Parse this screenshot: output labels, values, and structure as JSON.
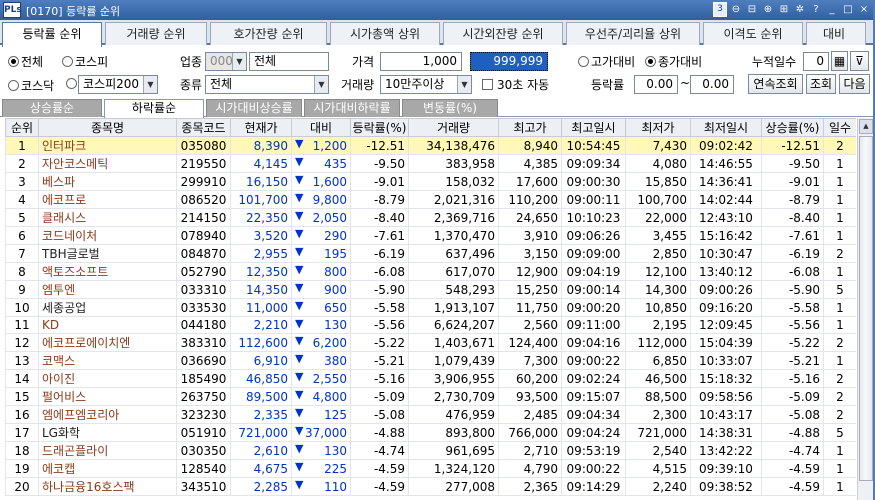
{
  "window": {
    "logo": "PLs",
    "title": "[0170] 등락률 순위",
    "icons": [
      "3",
      "magnify",
      "window",
      "zoom-in",
      "lock",
      "asterisk",
      "help",
      "minimize",
      "maximize",
      "close"
    ],
    "icon_glyphs": [
      "3",
      "⊖",
      "⊟",
      "⊕",
      "⊞",
      "✲",
      "?",
      "_",
      "□",
      "×"
    ]
  },
  "main_tabs": [
    "등락률 순위",
    "거래량 순위",
    "호가잔량 순위",
    "시가총액 상위",
    "시간외잔량 순위",
    "우선주/괴리율 상위",
    "이격도 순위",
    "대비"
  ],
  "filters": {
    "market_radios": [
      {
        "label": "전체",
        "checked": true
      },
      {
        "label": "코스피",
        "checked": false
      },
      {
        "label": "코스닥",
        "checked": false
      }
    ],
    "index_select": "코스피200",
    "sector_label": "업종",
    "sector_code": "0000",
    "sector_name": "전체",
    "type_label": "종류",
    "type_value": "전체",
    "price_label": "가격",
    "price_from": "1,000",
    "price_to": "999,999",
    "volume_label": "거래량",
    "volume_value": "10만주이상",
    "auto_label": "30초 자동",
    "compare_radios": [
      {
        "label": "고가대비",
        "checked": false
      },
      {
        "label": "종가대비",
        "checked": true
      }
    ],
    "rate_label": "등락률",
    "rate_from": "0.00",
    "rate_tilde": "~",
    "rate_to": "0.00",
    "days_label": "누적일수",
    "days_value": "0",
    "buttons": {
      "continuous": "연속조회",
      "query": "조회",
      "next": "다음"
    }
  },
  "sub_tabs": [
    "상승률순",
    "하락률순",
    "시가대비상승률",
    "시가대비하락률",
    "변동률(%)"
  ],
  "table": {
    "columns": [
      "순위",
      "종목명",
      "종목코드",
      "현재가",
      "대비",
      "등락률(%)",
      "거래량",
      "최고가",
      "최고일시",
      "최저가",
      "최저일시",
      "상승률(%)",
      "일수"
    ],
    "rows": [
      [
        "1",
        "인터파크",
        "035080",
        "8,390",
        "1,200",
        "-12.51",
        "34,138,476",
        "8,940",
        "10:54:45",
        "7,430",
        "09:02:42",
        "-12.51",
        "2"
      ],
      [
        "2",
        "자안코스메틱",
        "219550",
        "4,145",
        "435",
        "-9.50",
        "383,958",
        "4,385",
        "09:09:34",
        "4,080",
        "14:46:55",
        "-9.50",
        "1"
      ],
      [
        "3",
        "베스파",
        "299910",
        "16,150",
        "1,600",
        "-9.01",
        "158,032",
        "17,600",
        "09:00:30",
        "15,850",
        "14:36:41",
        "-9.01",
        "1"
      ],
      [
        "4",
        "에코프로",
        "086520",
        "101,700",
        "9,800",
        "-8.79",
        "2,021,316",
        "110,200",
        "09:00:11",
        "100,700",
        "14:02:44",
        "-8.79",
        "1"
      ],
      [
        "5",
        "클래시스",
        "214150",
        "22,350",
        "2,050",
        "-8.40",
        "2,369,716",
        "24,650",
        "10:10:23",
        "22,000",
        "12:43:10",
        "-8.40",
        "1"
      ],
      [
        "6",
        "코드네이처",
        "078940",
        "3,520",
        "290",
        "-7.61",
        "1,370,470",
        "3,910",
        "09:06:26",
        "3,455",
        "15:16:42",
        "-7.61",
        "1"
      ],
      [
        "7",
        "TBH글로벌",
        "084870",
        "2,955",
        "195",
        "-6.19",
        "637,496",
        "3,150",
        "09:09:00",
        "2,850",
        "10:30:47",
        "-6.19",
        "2"
      ],
      [
        "8",
        "액토즈소프트",
        "052790",
        "12,350",
        "800",
        "-6.08",
        "617,070",
        "12,900",
        "09:04:19",
        "12,100",
        "13:40:12",
        "-6.08",
        "1"
      ],
      [
        "9",
        "엠투엔",
        "033310",
        "14,350",
        "900",
        "-5.90",
        "548,293",
        "15,250",
        "09:00:14",
        "14,300",
        "09:00:26",
        "-5.90",
        "5"
      ],
      [
        "10",
        "세종공업",
        "033530",
        "11,000",
        "650",
        "-5.58",
        "1,913,107",
        "11,750",
        "09:00:20",
        "10,850",
        "09:16:20",
        "-5.58",
        "1"
      ],
      [
        "11",
        "KD",
        "044180",
        "2,210",
        "130",
        "-5.56",
        "6,624,207",
        "2,560",
        "09:11:00",
        "2,195",
        "12:09:45",
        "-5.56",
        "1"
      ],
      [
        "12",
        "에코프로에이치엔",
        "383310",
        "112,600",
        "6,200",
        "-5.22",
        "1,403,671",
        "124,400",
        "09:04:16",
        "112,000",
        "15:04:39",
        "-5.22",
        "2"
      ],
      [
        "13",
        "코맥스",
        "036690",
        "6,910",
        "380",
        "-5.21",
        "1,079,439",
        "7,300",
        "09:00:22",
        "6,850",
        "10:33:07",
        "-5.21",
        "1"
      ],
      [
        "14",
        "아이진",
        "185490",
        "46,850",
        "2,550",
        "-5.16",
        "3,906,955",
        "60,200",
        "09:02:24",
        "46,500",
        "15:18:32",
        "-5.16",
        "2"
      ],
      [
        "15",
        "펄어비스",
        "263750",
        "89,500",
        "4,800",
        "-5.09",
        "2,730,709",
        "93,500",
        "09:15:07",
        "88,500",
        "09:58:56",
        "-5.09",
        "2"
      ],
      [
        "16",
        "엠에프엠코리아",
        "323230",
        "2,335",
        "125",
        "-5.08",
        "476,959",
        "2,485",
        "09:04:34",
        "2,300",
        "10:43:17",
        "-5.08",
        "2"
      ],
      [
        "17",
        "LG화학",
        "051910",
        "721,000",
        "37,000",
        "-4.88",
        "893,800",
        "766,000",
        "09:04:24",
        "721,000",
        "14:38:31",
        "-4.88",
        "5"
      ],
      [
        "18",
        "드래곤플라이",
        "030350",
        "2,610",
        "130",
        "-4.74",
        "961,695",
        "2,710",
        "09:53:19",
        "2,540",
        "13:42:22",
        "-4.74",
        "1"
      ],
      [
        "19",
        "에코캡",
        "128540",
        "4,675",
        "225",
        "-4.59",
        "1,324,120",
        "4,790",
        "09:00:22",
        "4,515",
        "09:39:10",
        "-4.59",
        "1"
      ],
      [
        "20",
        "하나금융16호스팩",
        "343510",
        "2,285",
        "110",
        "-4.59",
        "277,008",
        "2,365",
        "09:14:29",
        "2,240",
        "09:38:52",
        "-4.59",
        "1"
      ]
    ],
    "plain_name_rows": [
      7,
      10,
      17
    ],
    "selected_row": 1,
    "colors": {
      "name": "#8b3a1a",
      "down": "#0033cc",
      "highlight": "#fff8b8"
    }
  }
}
